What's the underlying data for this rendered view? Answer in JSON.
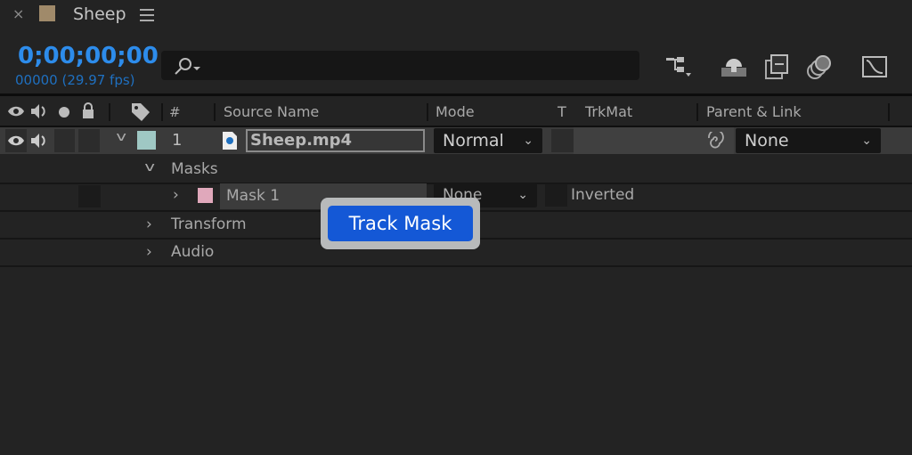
{
  "panel": {
    "title": "Sheep",
    "color": "#a08a6a",
    "close_icon": "close-icon",
    "menu_icon": "hamburger-menu-icon"
  },
  "time": {
    "timecode": "0;00;00;00",
    "frames": "00000 (29.97 fps)",
    "color": "#2d8ceb"
  },
  "search": {
    "placeholder": "",
    "icon": "search-icon"
  },
  "toolbar": {
    "icons": [
      "composition-flowchart-icon",
      "draft-3d-icon",
      "frame-blending-icon",
      "motion-blur-icon",
      "graph-editor-icon"
    ]
  },
  "columns": {
    "number": "#",
    "source_name": "Source Name",
    "mode": "Mode",
    "t": "T",
    "trkmat": "TrkMat",
    "parent": "Parent & Link"
  },
  "layer": {
    "index": "1",
    "name": "Sheep.mp4",
    "label_color": "#9fc8c4",
    "mode": "Normal",
    "parent": "None"
  },
  "tree": {
    "masks": "Masks",
    "mask1": {
      "name": "Mask 1",
      "color": "#e0a8bb",
      "mode": "None",
      "inverted": "Inverted"
    },
    "transform": "Transform",
    "audio": "Audio"
  },
  "tooltip": {
    "label": "Track Mask",
    "color": "#1458d6"
  }
}
